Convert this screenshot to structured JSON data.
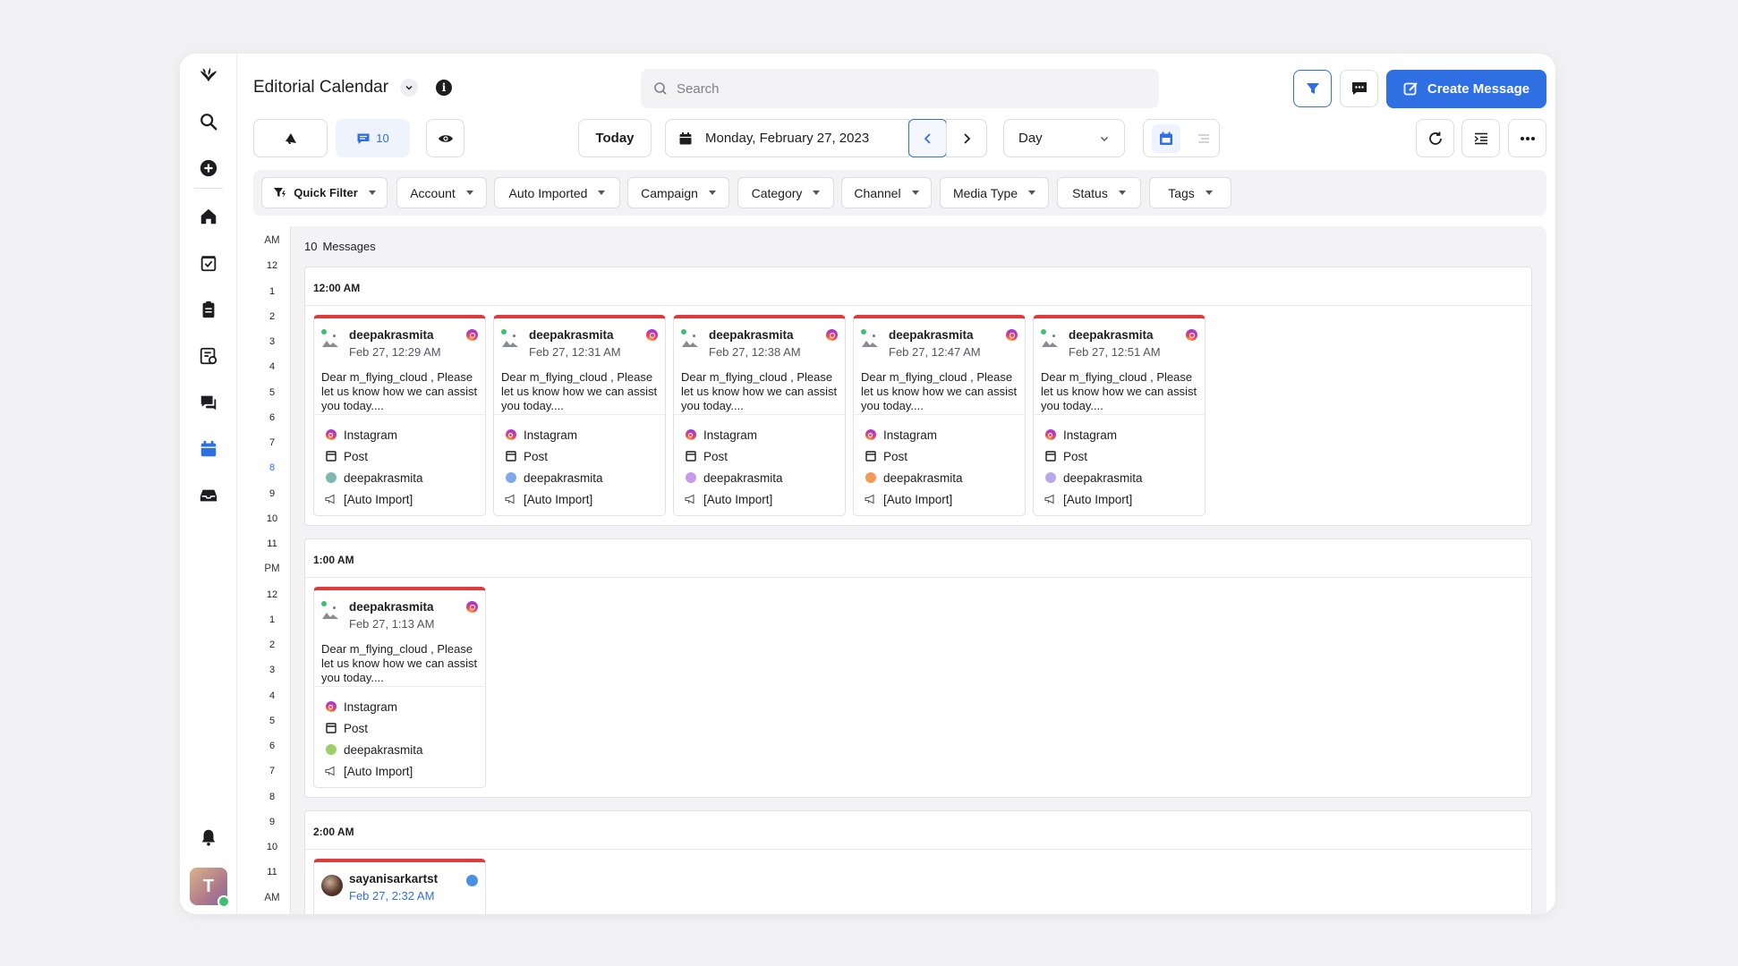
{
  "header": {
    "title": "Editorial Calendar",
    "search_placeholder": "Search",
    "create_label": "Create Message"
  },
  "toolbar": {
    "message_count": "10",
    "today_label": "Today",
    "date_label": "Monday, February 27, 2023",
    "view_label": "Day"
  },
  "filters": [
    "Quick Filter",
    "Account",
    "Auto Imported",
    "Campaign",
    "Category",
    "Channel",
    "Media Type",
    "Status",
    "Tags"
  ],
  "time_axis": {
    "labels": [
      "AM",
      "12",
      "1",
      "2",
      "3",
      "4",
      "5",
      "6",
      "7",
      "8",
      "9",
      "10",
      "11",
      "PM",
      "12",
      "1",
      "2",
      "3",
      "4",
      "5",
      "6",
      "7",
      "8",
      "9",
      "10",
      "11",
      "AM"
    ],
    "current_hour_index": 9
  },
  "calendar": {
    "count": "10",
    "count_label": "Messages",
    "slots": [
      {
        "label": "12:00 AM",
        "cards": [
          {
            "user": "deepakrasmita",
            "time": "Feb 27, 12:29 AM",
            "text": "Dear m_flying_cloud , Please let us know how we can assist you today....",
            "channel": "Instagram",
            "type": "Post",
            "account": "deepakrasmita",
            "account_color": "#7fb8b0",
            "campaign": "[Auto Import]"
          },
          {
            "user": "deepakrasmita",
            "time": "Feb 27, 12:31 AM",
            "text": "Dear m_flying_cloud , Please let us know how we can assist you today....",
            "channel": "Instagram",
            "type": "Post",
            "account": "deepakrasmita",
            "account_color": "#7fa8e8",
            "campaign": "[Auto Import]"
          },
          {
            "user": "deepakrasmita",
            "time": "Feb 27, 12:38 AM",
            "text": "Dear m_flying_cloud , Please let us know how we can assist you today....",
            "channel": "Instagram",
            "type": "Post",
            "account": "deepakrasmita",
            "account_color": "#c79be8",
            "campaign": "[Auto Import]"
          },
          {
            "user": "deepakrasmita",
            "time": "Feb 27, 12:47 AM",
            "text": "Dear m_flying_cloud , Please let us know how we can assist you today....",
            "channel": "Instagram",
            "type": "Post",
            "account": "deepakrasmita",
            "account_color": "#f39a5a",
            "campaign": "[Auto Import]"
          },
          {
            "user": "deepakrasmita",
            "time": "Feb 27, 12:51 AM",
            "text": "Dear m_flying_cloud , Please let us know how we can assist you today....",
            "channel": "Instagram",
            "type": "Post",
            "account": "deepakrasmita",
            "account_color": "#b9a8e8",
            "campaign": "[Auto Import]"
          }
        ]
      },
      {
        "label": "1:00 AM",
        "cards": [
          {
            "user": "deepakrasmita",
            "time": "Feb 27, 1:13 AM",
            "text": "Dear m_flying_cloud , Please let us know how we can assist you today....",
            "channel": "Instagram",
            "type": "Post",
            "account": "deepakrasmita",
            "account_color": "#9ccf6a",
            "campaign": "[Auto Import]"
          }
        ]
      },
      {
        "label": "2:00 AM",
        "cards": [
          {
            "user": "sayanisarkartst",
            "time": "Feb 27, 2:32 AM"
          }
        ]
      }
    ]
  }
}
